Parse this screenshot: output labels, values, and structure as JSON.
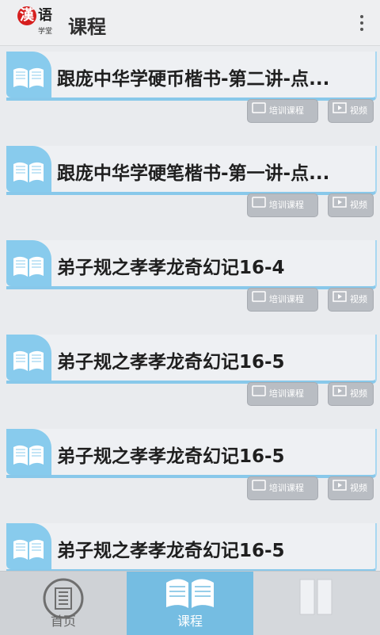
{
  "app": {
    "logo_main": "漢",
    "logo_main2": "语",
    "logo_sub": "学堂",
    "title": "课程"
  },
  "header": {
    "menu_icon": "overflow-menu-icon"
  },
  "courses": [
    {
      "title": "跟庞中华学硬币楷书-第二讲-点..."
    },
    {
      "title": "跟庞中华学硬笔楷书-第一讲-点..."
    },
    {
      "title": "弟子规之孝孝龙奇幻记16-4"
    },
    {
      "title": "弟子规之孝孝龙奇幻记16-5"
    },
    {
      "title": "弟子规之孝孝龙奇幻记16-5"
    },
    {
      "title": "弟子规之孝孝龙奇幻记16-5"
    }
  ],
  "actions": {
    "training_label": "培训课程",
    "video_label": "视频"
  },
  "tabs": [
    {
      "label": "首页"
    },
    {
      "label": "课程"
    },
    {
      "label": ""
    }
  ],
  "colors": {
    "accent": "#88cbed",
    "selected_tab": "#75bde2",
    "button": "#b9bdc3"
  }
}
